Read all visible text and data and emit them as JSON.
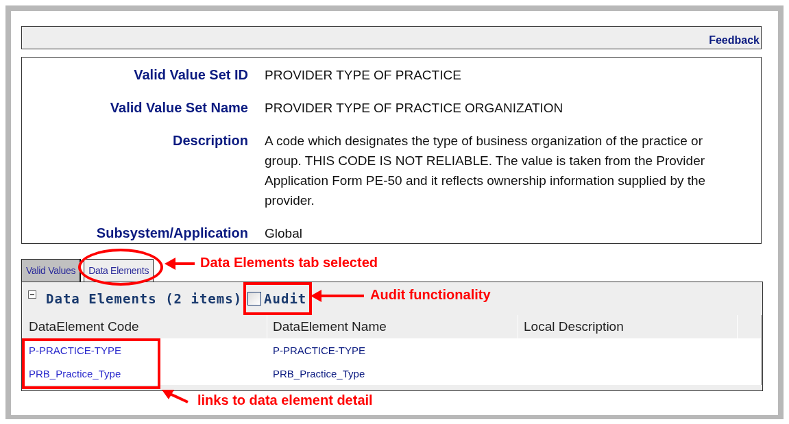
{
  "feedback_link": "Feedback",
  "details": [
    {
      "label": "Valid Value Set ID",
      "value": "PROVIDER TYPE OF PRACTICE"
    },
    {
      "label": "Valid Value Set Name",
      "value": "PROVIDER TYPE OF PRACTICE ORGANIZATION"
    },
    {
      "label": "Description",
      "value": "A code which designates the type of business organization of the practice or group. THIS CODE IS NOT RELIABLE. The value is taken from the Provider Application Form PE-50 and it reflects ownership information supplied by the provider."
    },
    {
      "label": "Subsystem/Application",
      "value": "Global"
    }
  ],
  "tabs": [
    {
      "label": "Valid Values",
      "selected": false
    },
    {
      "label": "Data Elements",
      "selected": true
    }
  ],
  "grid": {
    "title": "Data Elements (2 items)",
    "expanded": true,
    "audit": {
      "label": "Audit",
      "checked": false
    },
    "columns": [
      "DataElement Code",
      "DataElement Name",
      "Local Description"
    ],
    "rows": [
      {
        "code": "P-PRACTICE-TYPE",
        "name": "P-PRACTICE-TYPE"
      },
      {
        "code": "PRB_Practice_Type",
        "name": "PRB_Practice_Type"
      }
    ]
  },
  "annotations": [
    "Data Elements tab selected",
    "Audit functionality",
    "links to data element detail"
  ]
}
